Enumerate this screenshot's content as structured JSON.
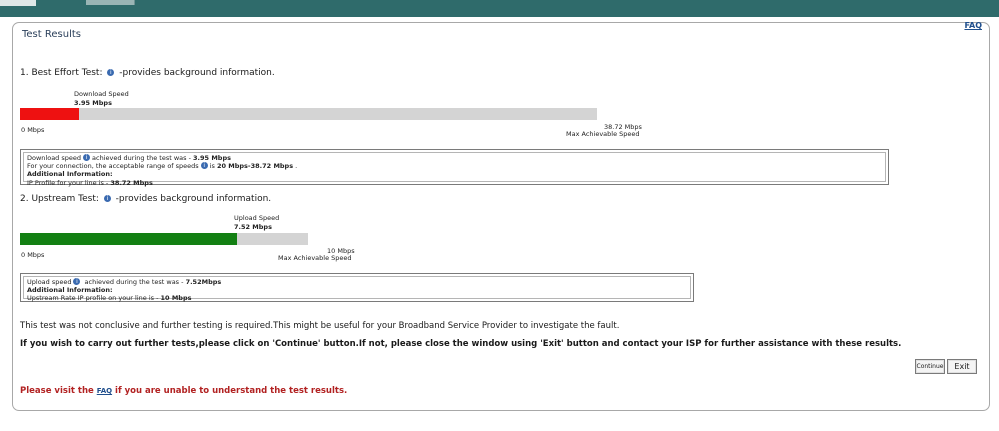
{
  "header": {
    "faq_label": "FAQ"
  },
  "panel": {
    "title": "Test Results"
  },
  "best_effort": {
    "heading_prefix": "1. Best Effort Test:",
    "heading_suffix": "-provides background information.",
    "speed_caption": "Download Speed",
    "speed_value": "3.95 Mbps",
    "min_label": "0 Mbps",
    "max_value": "38.72 Mbps",
    "max_caption": "Max Achievable Speed",
    "fill_fraction": 0.102,
    "fill_color": "#ee1111",
    "result": {
      "line1_prefix": "Download speed",
      "line1_mid": "achieved during the test was - ",
      "line1_value": "3.95 Mbps",
      "line2_prefix": "For your connection, the acceptable range of speeds",
      "line2_mid": "is ",
      "line2_value": "20 Mbps-38.72 Mbps",
      "line2_suffix": " .",
      "line3": "Additional Information:",
      "line4_prefix": "IP Profile for your line is - ",
      "line4_value": "38.72 Mbps"
    }
  },
  "upstream": {
    "heading_prefix": "2. Upstream Test:",
    "heading_suffix": "-provides background information.",
    "speed_caption": "Upload Speed",
    "speed_value": "7.52 Mbps",
    "min_label": "0 Mbps",
    "max_value": "10 Mbps",
    "max_caption": "Max Achievable Speed",
    "fill_fraction": 0.752,
    "fill_color": "#138013",
    "result": {
      "line1_prefix": "Upload speed",
      "line1_mid": " achieved during the test was - ",
      "line1_value": "7.52Mbps",
      "line2": "Additional Information:",
      "line3_prefix": "Upstream Rate IP profile on your line is - ",
      "line3_value": "10 Mbps"
    }
  },
  "messages": {
    "inconclusive": "This test was not conclusive and further testing is required.This might be useful for your Broadband Service Provider to investigate the fault.",
    "instructions": "If you wish to carry out further tests,please click on 'Continue' button.If not, please close the window using 'Exit' button and contact your ISP for further assistance with these results."
  },
  "buttons": {
    "continue_label": "Continue",
    "exit_label": "Exit"
  },
  "footer": {
    "visit_prefix": "Please visit the ",
    "faq_link": "FAQ",
    "visit_suffix": " if you are unable to understand the test results."
  },
  "icons": {
    "info": "info-icon"
  }
}
